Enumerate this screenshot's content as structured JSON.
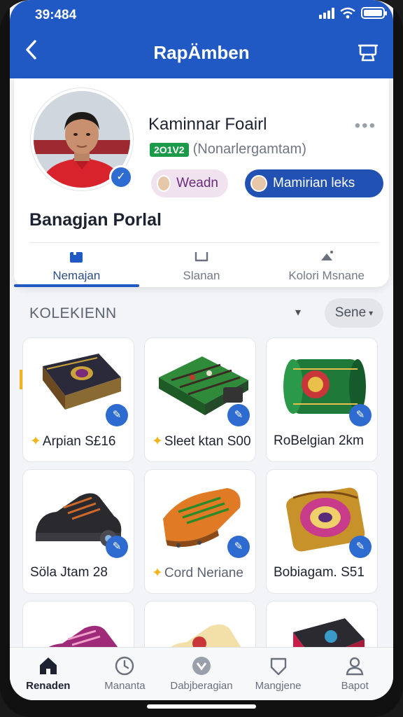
{
  "status": {
    "time": "39:484"
  },
  "header": {
    "title": "RapÄmben"
  },
  "profile": {
    "name": "Kaminnar Foairl",
    "id_badge": "2O1V2",
    "handle": "(Nonarlergamtam)",
    "chip_one": "Weadn",
    "chip_two": "Mamirian leks",
    "section_title": "Banagjan Porlal"
  },
  "tabs": [
    {
      "label": "Nemajan",
      "active": true
    },
    {
      "label": "Slanan",
      "active": false
    },
    {
      "label": "Kolori Msnane",
      "active": false
    }
  ],
  "collection": {
    "label": "KOLEKIENN",
    "sort_label": "Sene"
  },
  "products": [
    {
      "label": "Arpian S£16",
      "starred": true,
      "image": "board-game-box"
    },
    {
      "label": "Sleet ktan S00",
      "starred": true,
      "image": "football-table-game"
    },
    {
      "label": "RoBelgian 2km",
      "starred": false,
      "image": "green-roll"
    },
    {
      "label": "Söla Jtam 28",
      "starred": false,
      "image": "black-sneaker"
    },
    {
      "label": "Cord Neriane",
      "starred": true,
      "image": "orange-football-boot"
    },
    {
      "label": "Bobiagam. S51",
      "starred": false,
      "image": "ornate-bag"
    },
    {
      "label": "",
      "starred": false,
      "image": "purple-sneaker"
    },
    {
      "label": "",
      "starred": false,
      "image": "cream-sneaker"
    },
    {
      "label": "",
      "starred": false,
      "image": "black-red-bag"
    }
  ],
  "bottom_nav": [
    {
      "label": "Renaden",
      "icon": "home-icon",
      "active": true
    },
    {
      "label": "Mananta",
      "icon": "clock-face-icon",
      "active": false
    },
    {
      "label": "Dabjberagian",
      "icon": "game-controller-icon",
      "active": false
    },
    {
      "label": "Mangjene",
      "icon": "shield-icon",
      "active": false
    },
    {
      "label": "Bapot",
      "icon": "user-icon",
      "active": false
    }
  ],
  "colors": {
    "primary": "#2059c4",
    "accent": "#f0b41d",
    "badge_green": "#1b9a4a"
  }
}
